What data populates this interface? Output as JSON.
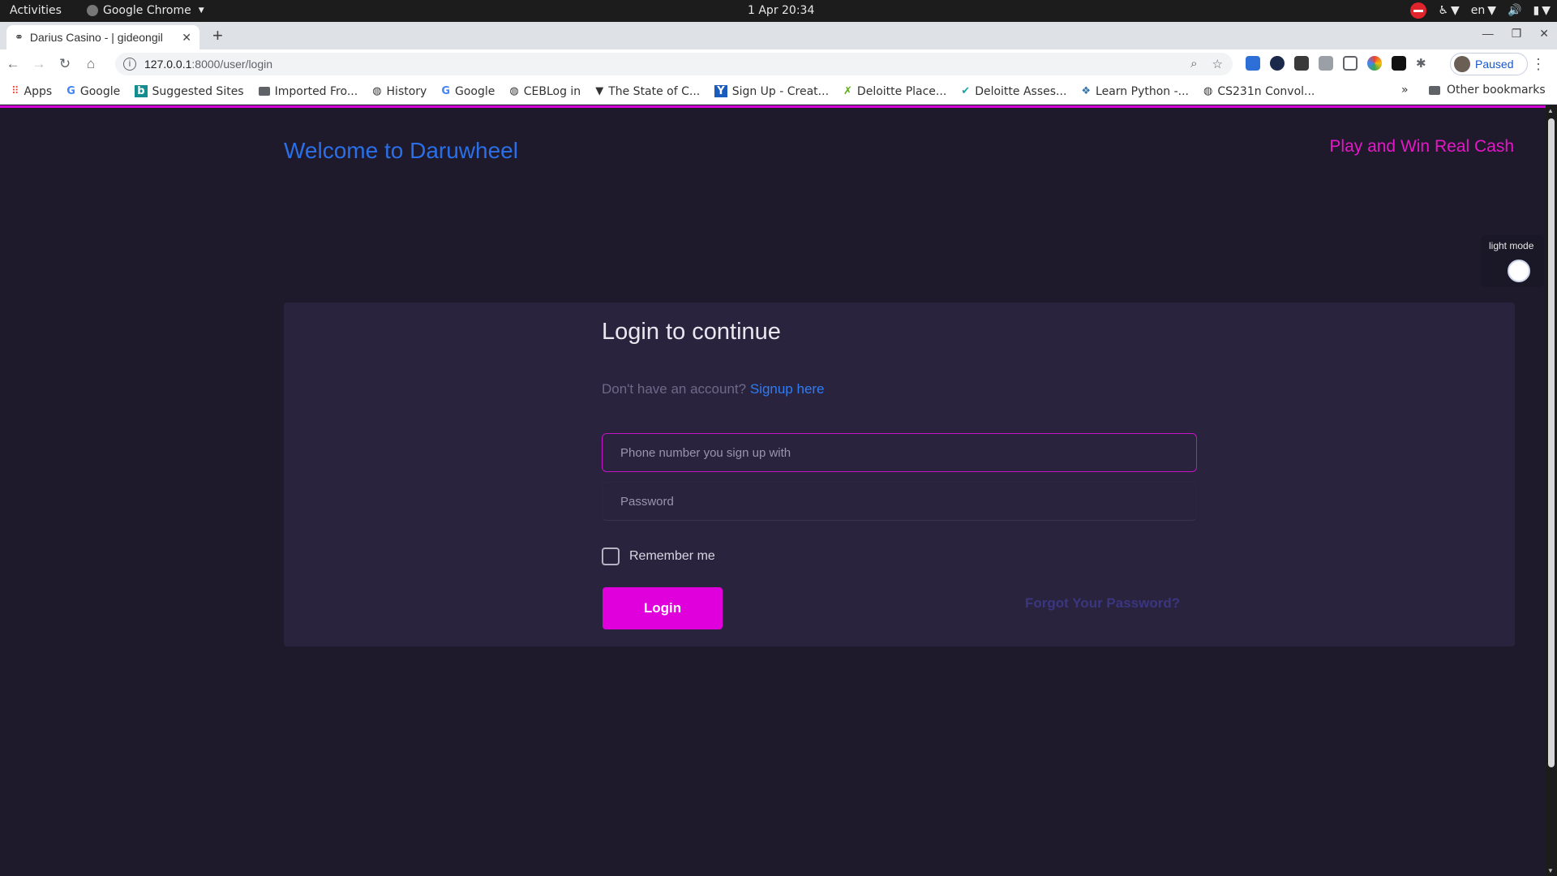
{
  "system": {
    "activities": "Activities",
    "app_name": "Google Chrome",
    "clock": "1 Apr  20:34",
    "lang": "en"
  },
  "browser": {
    "tab_title": "Darius Casino - | gideongil",
    "url_host": "127.0.0.1",
    "url_path": ":8000/user/login",
    "profile_label": "Paused",
    "bookmarks": [
      {
        "icon": "apps-grid-icon",
        "label": "Apps"
      },
      {
        "icon": "google-icon",
        "label": "Google"
      },
      {
        "icon": "bing-icon",
        "label": "Suggested Sites"
      },
      {
        "icon": "folder-icon",
        "label": "Imported Fro..."
      },
      {
        "icon": "globe-icon",
        "label": "History"
      },
      {
        "icon": "google-icon",
        "label": "Google"
      },
      {
        "icon": "globe-icon",
        "label": "CEBLog in"
      },
      {
        "icon": "state-icon",
        "label": "The State of C..."
      },
      {
        "icon": "ycombinator-icon",
        "label": "Sign Up - Creat..."
      },
      {
        "icon": "deloitte-icon",
        "label": "Deloitte Place..."
      },
      {
        "icon": "check-icon",
        "label": "Deloitte Asses..."
      },
      {
        "icon": "python-icon",
        "label": "Learn Python -..."
      },
      {
        "icon": "globe-icon",
        "label": "CS231n Convol..."
      }
    ],
    "bookmarks_more": "»",
    "other_bookmarks": "Other bookmarks"
  },
  "page": {
    "welcome": "Welcome to Daruwheel",
    "tagline": "Play and Win Real Cash",
    "mode_label": "light mode",
    "card_title": "Login to continue",
    "signup_prompt": "Don't have an account?",
    "signup_link": "Signup here",
    "phone_placeholder": "Phone number you sign up with",
    "password_placeholder": "Password",
    "remember_label": "Remember me",
    "login_button": "Login",
    "forgot_link": "Forgot Your Password?"
  },
  "colors": {
    "background": "#1e1a2b",
    "card": "#29233d",
    "accent_magenta": "#e000dc",
    "link_blue": "#2b6fe8"
  }
}
